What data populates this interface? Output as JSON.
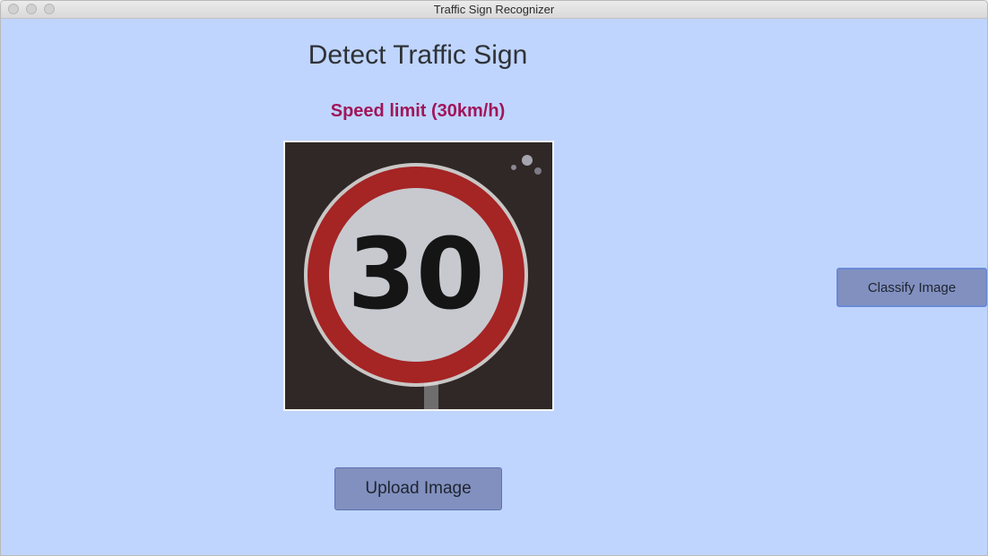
{
  "window": {
    "title": "Traffic Sign Recognizer"
  },
  "main": {
    "heading": "Detect Traffic Sign",
    "prediction": "Speed limit (30km/h)",
    "sign_image": {
      "number": "30",
      "colors": {
        "ring": "#a52424",
        "face": "#c7c9cf",
        "digits": "#151515",
        "background": "#2b2624"
      }
    },
    "upload_label": "Upload Image",
    "classify_label": "Classify Image"
  },
  "colors": {
    "background": "#bfd5fe",
    "button": "#8190bf",
    "prediction_text": "#a1155a"
  }
}
